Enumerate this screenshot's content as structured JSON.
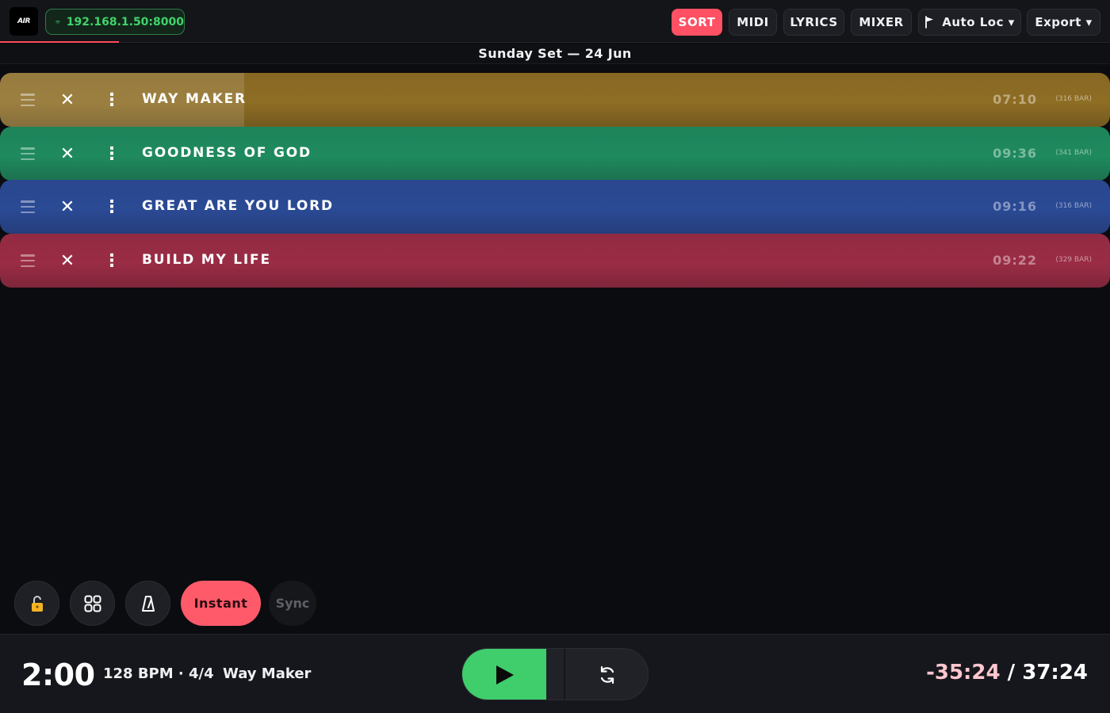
{
  "app": {
    "logo_text": "AIR",
    "connection": {
      "ip": "192.168.1.50:8000"
    }
  },
  "toolbar": {
    "sort_label": "SORT",
    "midi_label": "MIDI",
    "lyrics_label": "LYRICS",
    "mixer_label": "MIXER",
    "autoloc_label": "Auto Loc ▾",
    "export_label": "Export ▾"
  },
  "setlist": {
    "title": "Sunday Set — 24 Jun",
    "songs": [
      {
        "title": "WAY MAKER",
        "duration": "07:10",
        "bars": "(316 BAR)",
        "color": "#8e6d24",
        "progress": 0.22
      },
      {
        "title": "GOODNESS OF GOD",
        "duration": "09:36",
        "bars": "(341 BAR)",
        "color": "#1f8a5e",
        "progress": 0
      },
      {
        "title": "GREAT ARE YOU LORD",
        "duration": "09:16",
        "bars": "(316 BAR)",
        "color": "#2b4a95",
        "progress": 0
      },
      {
        "title": "BUILD MY LIFE",
        "duration": "09:22",
        "bars": "(329 BAR)",
        "color": "#9a2c45",
        "progress": 0
      }
    ]
  },
  "controls": {
    "instant_label": "Instant",
    "sync_label": "Sync"
  },
  "transport": {
    "clock": "2:00",
    "tempo": "128 BPM · 4/4",
    "current_song": "Way Maker",
    "remaining": "-35:24",
    "separator": " / ",
    "total": "37:24"
  },
  "colors": {
    "accent": "#ff5064",
    "play": "#3fce6b",
    "connection": "#41d36b"
  }
}
